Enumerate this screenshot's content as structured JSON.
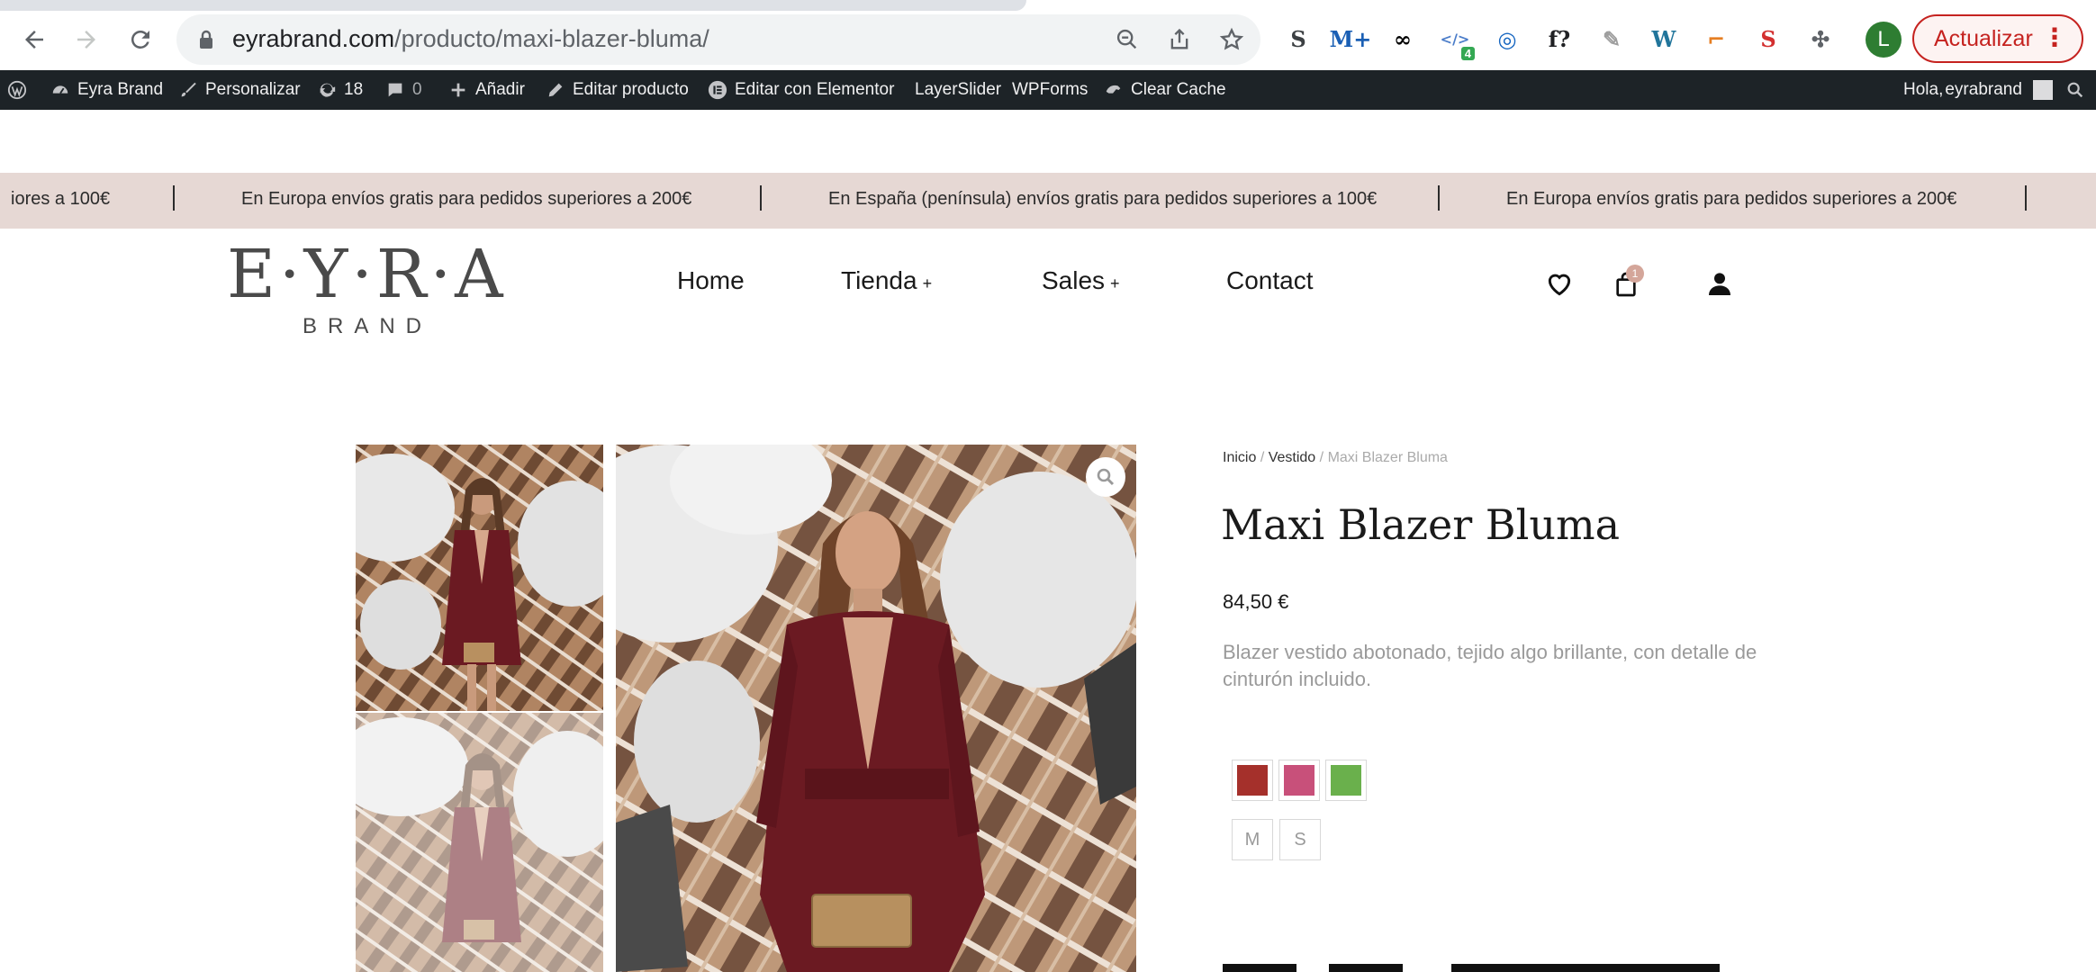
{
  "browser": {
    "url_host": "eyrabrand.com",
    "url_path": "/producto/maxi-blazer-bluma/",
    "profile_initial": "L",
    "update_label": "Actualizar",
    "extensions": [
      {
        "name": "s-extension-icon",
        "text": "S",
        "color": "#3c4043"
      },
      {
        "name": "m-plus-extension-icon",
        "text": "M+",
        "color": "#1a5fb4"
      },
      {
        "name": "infinity-extension-icon",
        "text": "∞",
        "color": "#000000"
      },
      {
        "name": "code-extension-icon",
        "text": "</>",
        "color": "#4a7cc9",
        "badge": "4"
      },
      {
        "name": "target-extension-icon",
        "text": "◎",
        "color": "#1565c0"
      },
      {
        "name": "font-extension-icon",
        "text": "f?",
        "color": "#202124"
      },
      {
        "name": "eyedropper-extension-icon",
        "text": "✎",
        "color": "#9e9e9e"
      },
      {
        "name": "wordpress-extension-icon",
        "text": "W",
        "color": "#21759b"
      },
      {
        "name": "ruler-extension-icon",
        "text": "⌐",
        "color": "#e67e22"
      },
      {
        "name": "seo-extension-icon",
        "text": "S",
        "color": "#d32f2f"
      },
      {
        "name": "puzzle-extension-icon",
        "text": "✣",
        "color": "#5f6368"
      }
    ]
  },
  "admin_bar": {
    "site_name": "Eyra Brand",
    "customize": "Personalizar",
    "updates_count": "18",
    "comments_count": "0",
    "add_new": "Añadir",
    "edit_product": "Editar producto",
    "edit_elementor": "Editar con Elementor",
    "layerslider": "LayerSlider",
    "wpforms": "WPForms",
    "clear_cache": "Clear Cache",
    "greeting": "Hola,",
    "username": "eyrabrand"
  },
  "announcement": {
    "partial": "iores a 100€",
    "europe": "En Europa envíos gratis para pedidos superiores a 200€",
    "spain": "En España (península) envíos gratis para pedidos superiores a 100€"
  },
  "header": {
    "logo_main": "E·Y·R·A",
    "logo_sub": "BRAND",
    "menu": {
      "home": "Home",
      "tienda": "Tienda",
      "sales": "Sales",
      "contact": "Contact",
      "plus": "+"
    },
    "cart_count": "1"
  },
  "product": {
    "breadcrumb_home": "Inicio",
    "breadcrumb_sep": "/",
    "breadcrumb_category": "Vestido",
    "breadcrumb_current": "Maxi Blazer Bluma",
    "title": "Maxi Blazer Bluma",
    "price": "84,50 €",
    "description": "Blazer vestido abotonado, tejido algo brillante, con detalle de cinturón incluido.",
    "colors": [
      "#a5302b",
      "#c8507a",
      "#6ab04c"
    ],
    "sizes": [
      "M",
      "S"
    ]
  }
}
